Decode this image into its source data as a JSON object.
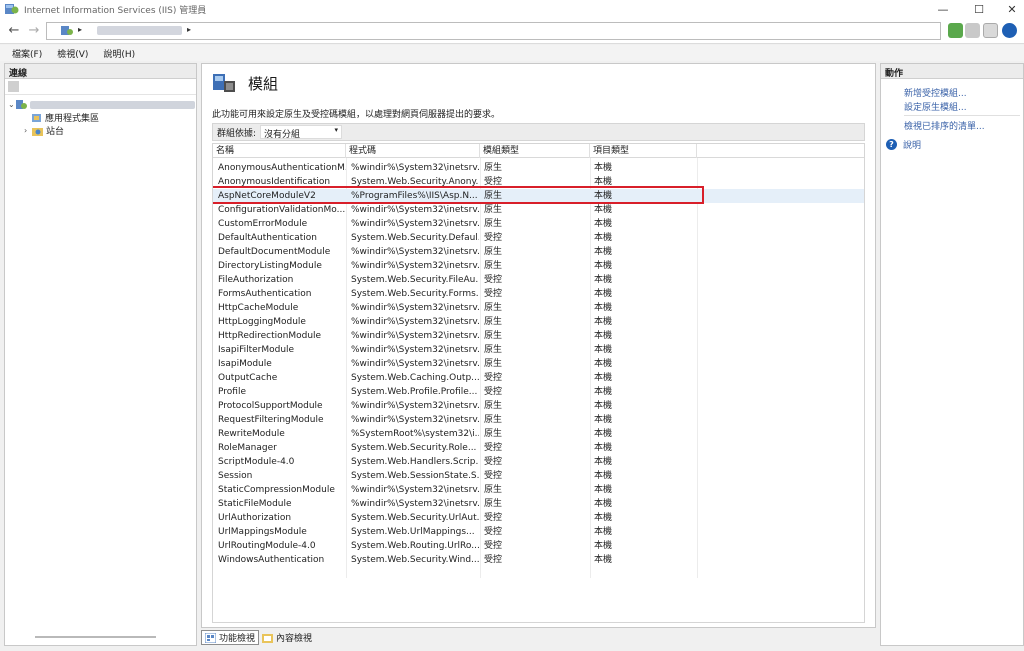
{
  "window": {
    "title": "Internet Information Services (IIS) 管理員"
  },
  "window_controls": {
    "minimize": "—",
    "maximize": "☐",
    "close": "✕"
  },
  "address": {
    "separator": "▸"
  },
  "menu": [
    "檔案(F)",
    "檢視(V)",
    "說明(H)"
  ],
  "connections": {
    "header": "連線",
    "tree": [
      {
        "label": "應用程式集區"
      },
      {
        "label": "站台"
      }
    ]
  },
  "main": {
    "title": "模組",
    "description": "此功能可用來設定原生及受控碼模組，以處理對網頁伺服器提出的要求。",
    "group_label": "群組依據:",
    "group_value": "沒有分組",
    "columns": [
      "名稱",
      "程式碼",
      "模組類型",
      "項目類型"
    ],
    "rows": [
      {
        "name": "AnonymousAuthenticationM...",
        "code": "%windir%\\System32\\inetsrv...",
        "type": "原生",
        "entry": "本機"
      },
      {
        "name": "AnonymousIdentification",
        "code": "System.Web.Security.Anony...",
        "type": "受控",
        "entry": "本機"
      },
      {
        "name": "AspNetCoreModuleV2",
        "code": "%ProgramFiles%\\IIS\\Asp.N...",
        "type": "原生",
        "entry": "本機"
      },
      {
        "name": "ConfigurationValidationMo...",
        "code": "%windir%\\System32\\inetsrv...",
        "type": "原生",
        "entry": "本機"
      },
      {
        "name": "CustomErrorModule",
        "code": "%windir%\\System32\\inetsrv...",
        "type": "原生",
        "entry": "本機"
      },
      {
        "name": "DefaultAuthentication",
        "code": "System.Web.Security.Defaul...",
        "type": "受控",
        "entry": "本機"
      },
      {
        "name": "DefaultDocumentModule",
        "code": "%windir%\\System32\\inetsrv...",
        "type": "原生",
        "entry": "本機"
      },
      {
        "name": "DirectoryListingModule",
        "code": "%windir%\\System32\\inetsrv...",
        "type": "原生",
        "entry": "本機"
      },
      {
        "name": "FileAuthorization",
        "code": "System.Web.Security.FileAu...",
        "type": "受控",
        "entry": "本機"
      },
      {
        "name": "FormsAuthentication",
        "code": "System.Web.Security.Forms...",
        "type": "受控",
        "entry": "本機"
      },
      {
        "name": "HttpCacheModule",
        "code": "%windir%\\System32\\inetsrv...",
        "type": "原生",
        "entry": "本機"
      },
      {
        "name": "HttpLoggingModule",
        "code": "%windir%\\System32\\inetsrv...",
        "type": "原生",
        "entry": "本機"
      },
      {
        "name": "HttpRedirectionModule",
        "code": "%windir%\\System32\\inetsrv...",
        "type": "原生",
        "entry": "本機"
      },
      {
        "name": "IsapiFilterModule",
        "code": "%windir%\\System32\\inetsrv...",
        "type": "原生",
        "entry": "本機"
      },
      {
        "name": "IsapiModule",
        "code": "%windir%\\System32\\inetsrv...",
        "type": "原生",
        "entry": "本機"
      },
      {
        "name": "OutputCache",
        "code": "System.Web.Caching.Outp...",
        "type": "受控",
        "entry": "本機"
      },
      {
        "name": "Profile",
        "code": "System.Web.Profile.Profile...",
        "type": "受控",
        "entry": "本機"
      },
      {
        "name": "ProtocolSupportModule",
        "code": "%windir%\\System32\\inetsrv...",
        "type": "原生",
        "entry": "本機"
      },
      {
        "name": "RequestFilteringModule",
        "code": "%windir%\\System32\\inetsrv...",
        "type": "原生",
        "entry": "本機"
      },
      {
        "name": "RewriteModule",
        "code": "%SystemRoot%\\system32\\i...",
        "type": "原生",
        "entry": "本機"
      },
      {
        "name": "RoleManager",
        "code": "System.Web.Security.Role...",
        "type": "受控",
        "entry": "本機"
      },
      {
        "name": "ScriptModule-4.0",
        "code": "System.Web.Handlers.Scrip...",
        "type": "受控",
        "entry": "本機"
      },
      {
        "name": "Session",
        "code": "System.Web.SessionState.S...",
        "type": "受控",
        "entry": "本機"
      },
      {
        "name": "StaticCompressionModule",
        "code": "%windir%\\System32\\inetsrv...",
        "type": "原生",
        "entry": "本機"
      },
      {
        "name": "StaticFileModule",
        "code": "%windir%\\System32\\inetsrv...",
        "type": "原生",
        "entry": "本機"
      },
      {
        "name": "UrlAuthorization",
        "code": "System.Web.Security.UrlAut...",
        "type": "受控",
        "entry": "本機"
      },
      {
        "name": "UrlMappingsModule",
        "code": "System.Web.UrlMappings...",
        "type": "受控",
        "entry": "本機"
      },
      {
        "name": "UrlRoutingModule-4.0",
        "code": "System.Web.Routing.UrlRo...",
        "type": "受控",
        "entry": "本機"
      },
      {
        "name": "WindowsAuthentication",
        "code": "System.Web.Security.Wind...",
        "type": "受控",
        "entry": "本機"
      }
    ],
    "selected_row_index": 2
  },
  "bottom_tabs": {
    "features": "功能檢視",
    "content": "內容檢視"
  },
  "actions": {
    "header": "動作",
    "links": [
      "新增受控模組...",
      "設定原生模組...",
      "檢視已排序的清單..."
    ],
    "help": "說明"
  },
  "colors": {
    "accent_link": "#3a62a8",
    "highlight": "#d81f2a",
    "selected_row": "#e5eff9"
  }
}
